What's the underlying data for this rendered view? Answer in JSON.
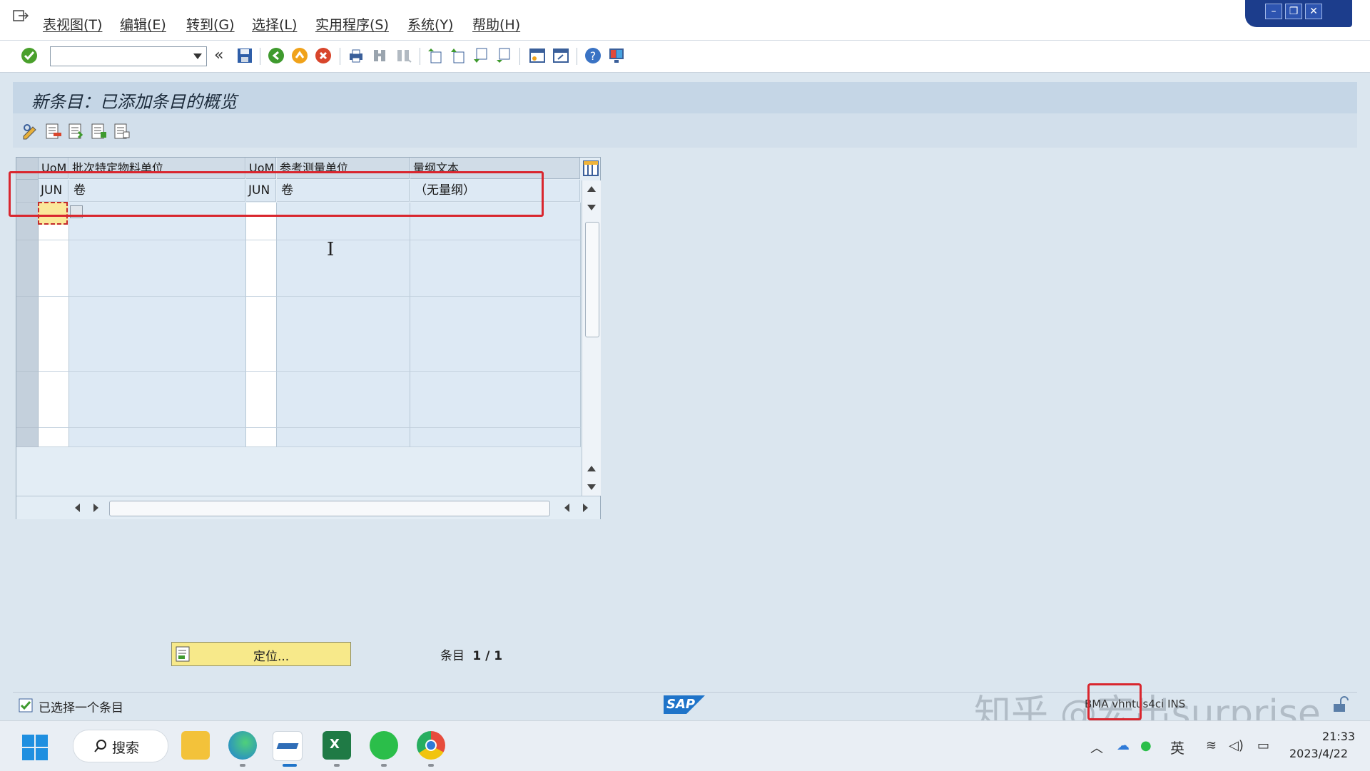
{
  "menubar": {
    "items": [
      {
        "label": "表视图(T)"
      },
      {
        "label": "编辑(E)"
      },
      {
        "label": "转到(G)"
      },
      {
        "label": "选择(L)"
      },
      {
        "label": "实用程序(S)"
      },
      {
        "label": "系统(Y)"
      },
      {
        "label": "帮助(H)"
      }
    ]
  },
  "toolbar": {
    "command_field_value": "",
    "icons": [
      "enter-icon",
      "command-dropdown-icon",
      "back-arrows-icon",
      "save-icon",
      "back-icon",
      "exit-icon",
      "cancel-icon",
      "print-icon",
      "find-icon",
      "find-next-icon",
      "first-page-icon",
      "previous-page-icon",
      "next-page-icon",
      "last-page-icon",
      "create-session-icon",
      "shortcut-icon",
      "help-icon",
      "customize-layout-icon"
    ]
  },
  "page": {
    "title": "新条目：已添加条目的概览"
  },
  "table": {
    "columns": [
      {
        "label": "UoM"
      },
      {
        "label": "批次特定物料单位"
      },
      {
        "label": "UoM"
      },
      {
        "label": "参考测量单位"
      },
      {
        "label": "量纲文本"
      }
    ],
    "rows": [
      {
        "uom1": "JUN",
        "text1": "卷",
        "uom2": "JUN",
        "text2": "卷",
        "dim": "（无量纲）"
      }
    ],
    "empty_row_count": 13
  },
  "footer": {
    "locate_label": "定位...",
    "entry_label": "条目",
    "entry_value": "1 / 1"
  },
  "status": {
    "message": "已选择一个条目",
    "sap_logo": "SAP",
    "system_info": "BMA  vhntus4ci  INS",
    "watermark": "知乎 @宏出surprise"
  },
  "taskbar": {
    "search_label": "搜索",
    "ime_label": "英",
    "time": "21:33",
    "date": "2023/4/22",
    "apps": [
      "file-explorer-icon",
      "edge-icon",
      "sap-logon-icon",
      "excel-icon",
      "wechat-icon",
      "chrome-icon"
    ]
  },
  "colors": {
    "accent_red": "#d9262e",
    "sap_blue": "#1c3d8c",
    "locate_yellow": "#f7e98a"
  }
}
